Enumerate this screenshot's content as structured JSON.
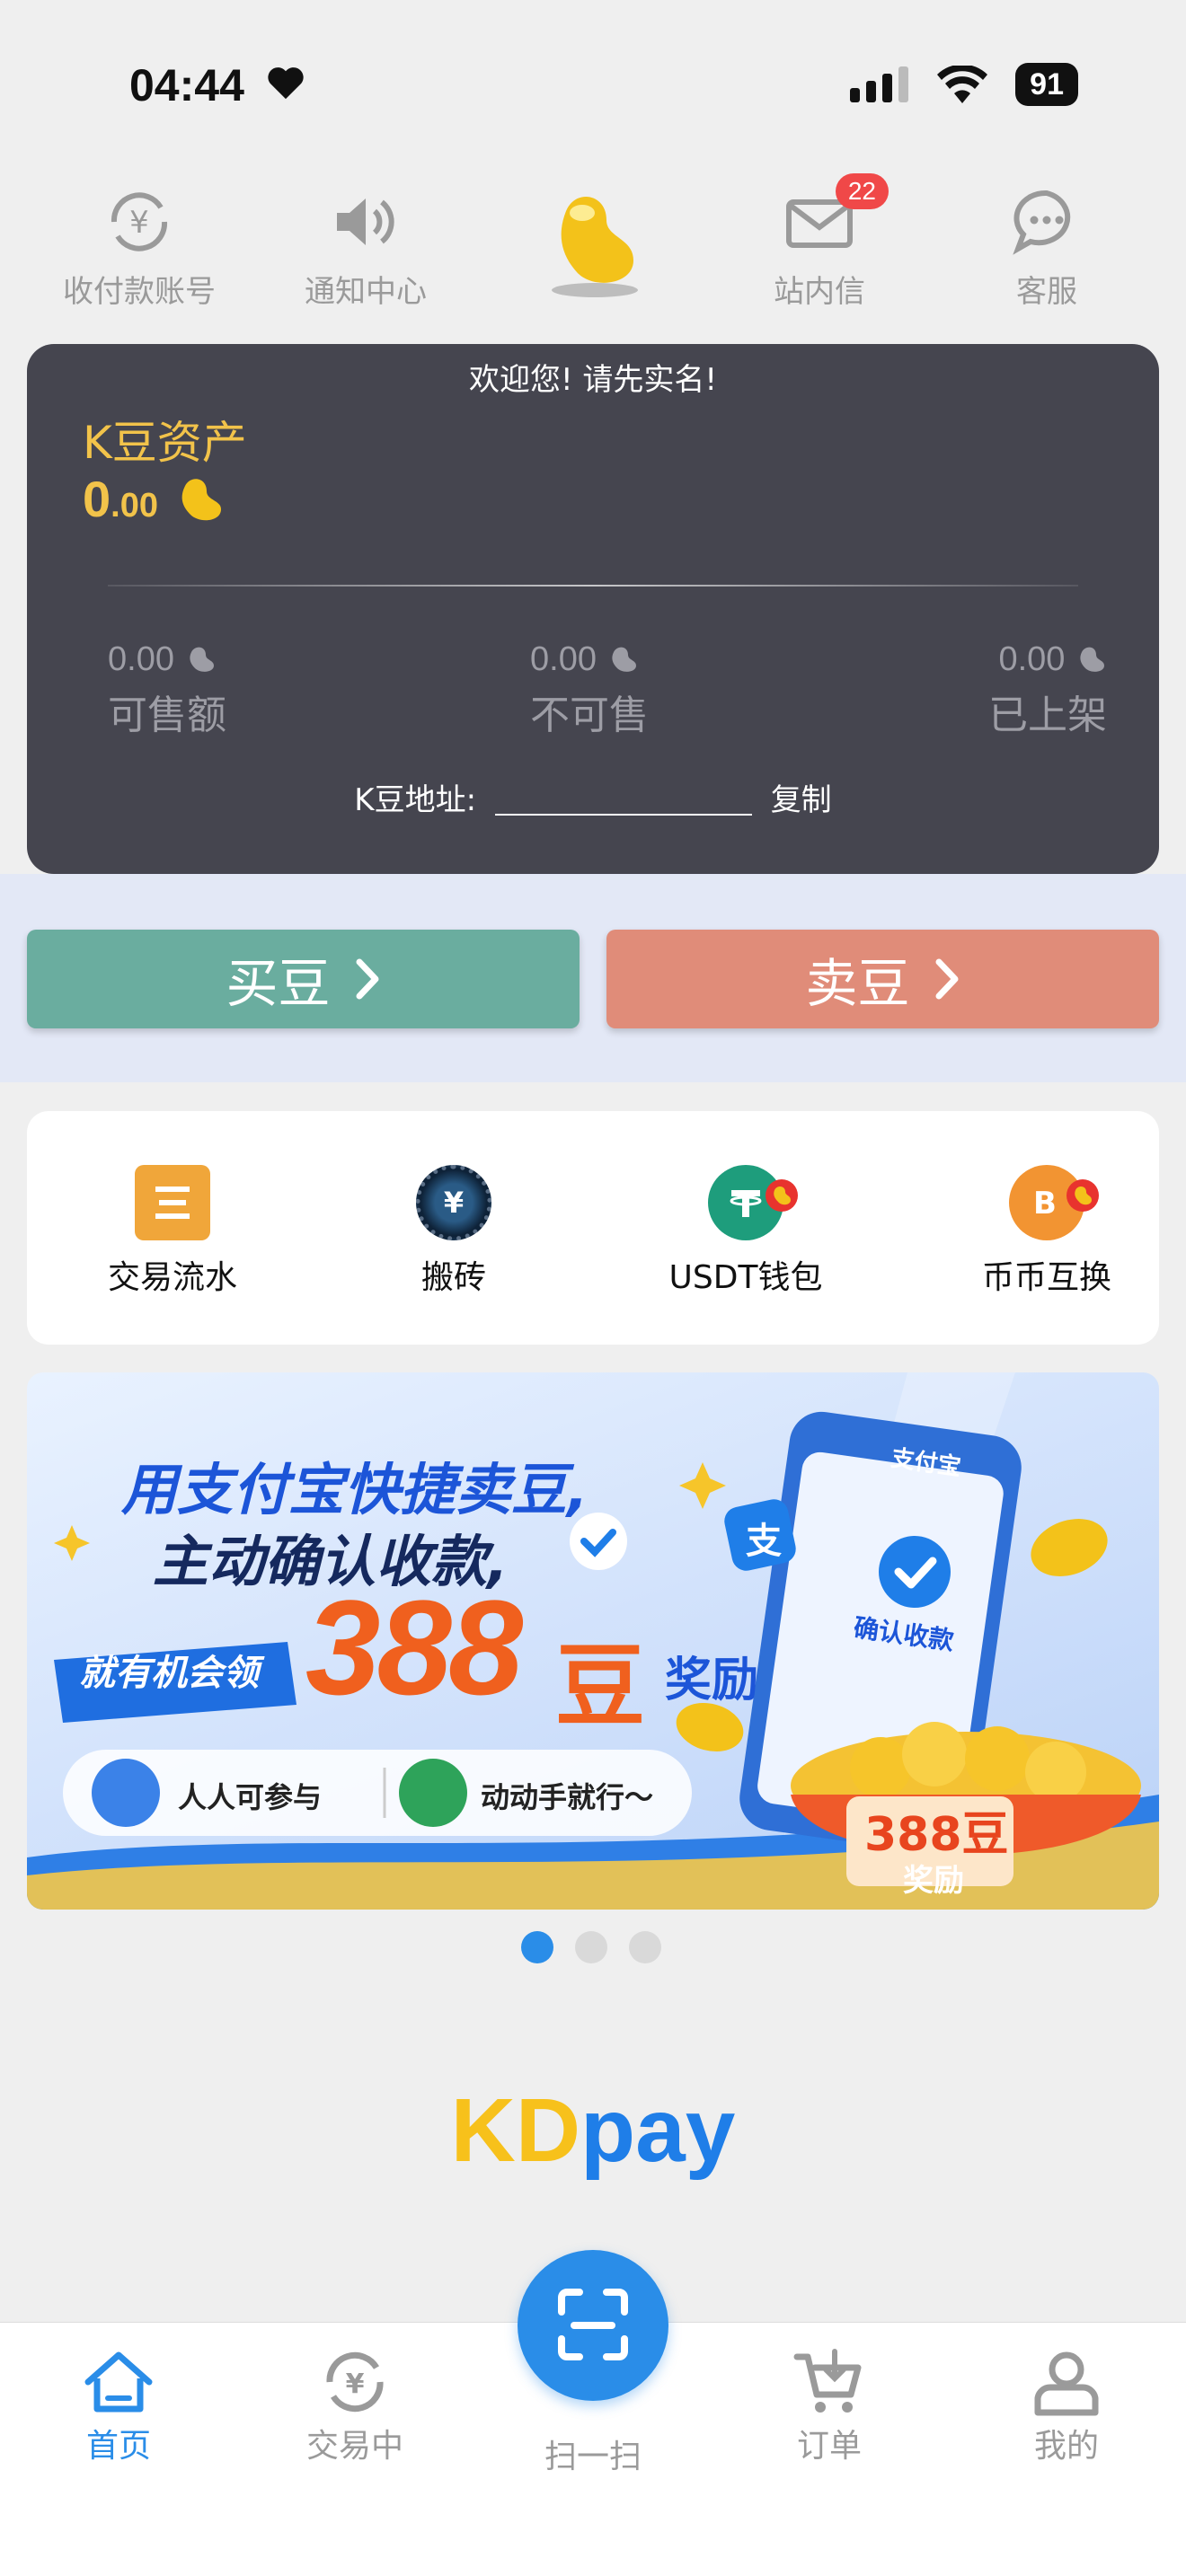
{
  "status": {
    "time": "04:44",
    "battery": "91"
  },
  "top_nav": [
    {
      "label": "收付款账号",
      "icon": "yuan-refresh-icon"
    },
    {
      "label": "通知中心",
      "icon": "speaker-icon"
    },
    {
      "label": "",
      "icon": "golden-bean-icon"
    },
    {
      "label": "站内信",
      "icon": "envelope-icon",
      "badge": "22"
    },
    {
      "label": "客服",
      "icon": "chat-bubble-icon"
    }
  ],
  "asset_card": {
    "welcome": "欢迎您! 请先实名!",
    "title": "K豆资产",
    "value_int": "0",
    "value_dec": ".00",
    "stats": [
      {
        "value": "0.00",
        "label": "可售额"
      },
      {
        "value": "0.00",
        "label": "不可售"
      },
      {
        "value": "0.00",
        "label": "已上架"
      }
    ],
    "address_label": "K豆地址:",
    "copy_label": "复制"
  },
  "actions": {
    "buy": "买豆",
    "sell": "卖豆"
  },
  "quick_menu": [
    {
      "label": "交易流水",
      "icon": "list-icon",
      "color": "#f0a63a"
    },
    {
      "label": "搬砖",
      "icon": "earn-icon",
      "color": "#1f3f5e"
    },
    {
      "label": "USDT钱包",
      "icon": "tether-icon",
      "color": "#1e9d7c"
    },
    {
      "label": "币币互换",
      "icon": "bitcoin-icon",
      "color": "#f29432"
    }
  ],
  "banner": {
    "line1": "用支付宝快捷卖豆,",
    "line2": "主动确认收款,",
    "tag": "就有机会领",
    "amount": "388",
    "bean": "豆",
    "reward": "奖励",
    "pill1": "人人可参与",
    "pill2": "动动手就行～",
    "phone_brand": "支付宝",
    "phone_confirm": "确认收款",
    "bowl_amount": "388豆",
    "bowl_reward": "奖励",
    "alipay_glyph": "支",
    "page_dots": 3,
    "active_dot": 0
  },
  "logo": {
    "part1": "KD",
    "part2": "pay",
    "color1": "#f7c11b",
    "color2": "#1f7ee8"
  },
  "tabs": [
    {
      "label": "首页",
      "active": true
    },
    {
      "label": "交易中",
      "active": false
    },
    {
      "label": "扫一扫",
      "active": false
    },
    {
      "label": "订单",
      "active": false
    },
    {
      "label": "我的",
      "active": false
    }
  ],
  "colors": {
    "accent": "#2a8de8",
    "card": "#45454f",
    "gold": "#f2c34a",
    "buy": "#6aad9f",
    "sell": "#e08c79"
  }
}
